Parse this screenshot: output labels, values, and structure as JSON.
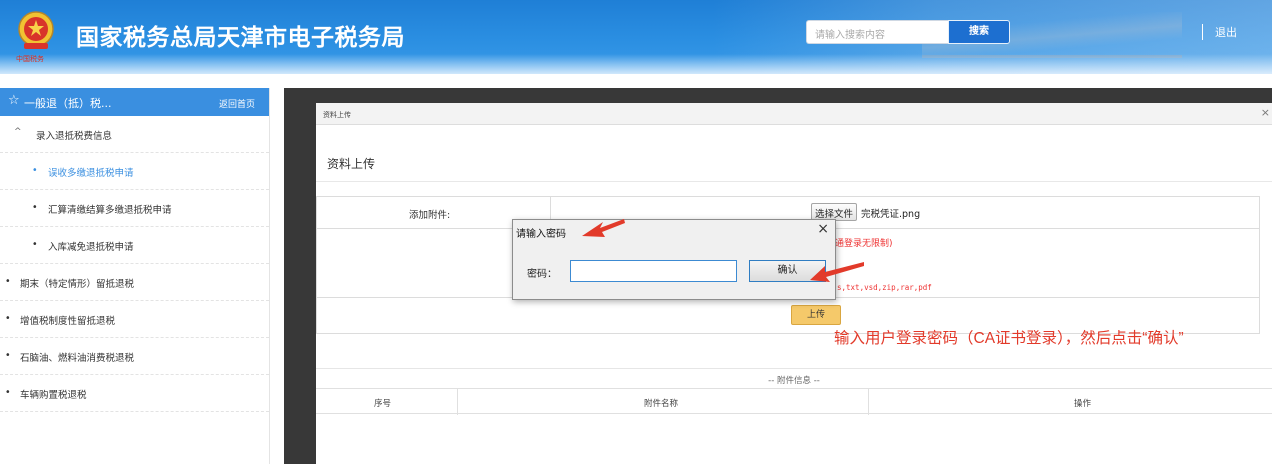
{
  "header": {
    "title": "国家税务总局天津市电子税务局",
    "search_placeholder": "请输入搜索内容",
    "search_button": "搜索",
    "logout": "退出",
    "emblem_icon": "tax-emblem-icon",
    "brand_color": "#2b8fe2"
  },
  "sidebar": {
    "title": "一般退（抵）税...",
    "back_home": "返回首页",
    "items": [
      {
        "label": "录入退抵税费信息",
        "prefix": "^"
      },
      {
        "label": "误收多缴退抵税申请",
        "prefix": "•"
      },
      {
        "label": "汇算清缴结算多缴退抵税申请",
        "prefix": "•"
      },
      {
        "label": "入库减免退抵税申请",
        "prefix": "•"
      },
      {
        "label": "期末（特定情形）留抵退税",
        "prefix": "•"
      },
      {
        "label": "增值税制度性留抵退税",
        "prefix": "•"
      },
      {
        "label": "石脑油、燃料油消费税退税",
        "prefix": "•"
      },
      {
        "label": "车辆购置税退税",
        "prefix": "•"
      }
    ]
  },
  "dialog": {
    "window_title": "资料上传",
    "close": "×",
    "heading": "资料上传",
    "attach_label": "添加附件:",
    "choose_file_button": "选择文件",
    "file_name": "完税凭证.png",
    "note_1": "通登录无限制)",
    "note_2": "s,txt,vsd,zip,rar,pdf",
    "upload_button": "上传",
    "attach_info_title": "-- 附件信息 --",
    "columns": [
      "序号",
      "附件名称",
      "操作"
    ]
  },
  "password_prompt": {
    "title": "请输入密码",
    "close": "×",
    "label": "密码：",
    "value": "",
    "ok_button": "确认"
  },
  "annotation": {
    "text": "输入用户登录密码（CA证书登录），然后点击“确认”",
    "color": "#e23a2a"
  }
}
